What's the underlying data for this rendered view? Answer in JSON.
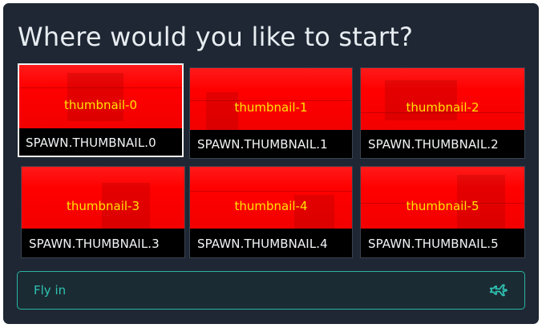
{
  "dialog": {
    "title": "Where would you like to start?"
  },
  "spawn_options": [
    {
      "thumbnail_label": "thumbnail-0",
      "caption": "SPAWN.THUMBNAIL.0",
      "selected": true
    },
    {
      "thumbnail_label": "thumbnail-1",
      "caption": "SPAWN.THUMBNAIL.1",
      "selected": false
    },
    {
      "thumbnail_label": "thumbnail-2",
      "caption": "SPAWN.THUMBNAIL.2",
      "selected": false
    },
    {
      "thumbnail_label": "thumbnail-3",
      "caption": "SPAWN.THUMBNAIL.3",
      "selected": false
    },
    {
      "thumbnail_label": "thumbnail-4",
      "caption": "SPAWN.THUMBNAIL.4",
      "selected": false
    },
    {
      "thumbnail_label": "thumbnail-5",
      "caption": "SPAWN.THUMBNAIL.5",
      "selected": false
    }
  ],
  "fly_button": {
    "label": "Fly in",
    "icon": "airplane-icon"
  },
  "colors": {
    "panel_bg": "#1e2733",
    "thumbnail_bg": "#ff0000",
    "thumbnail_label": "#ffe400",
    "accent": "#2bb3a3",
    "selected_border": "#f2f2f2"
  }
}
